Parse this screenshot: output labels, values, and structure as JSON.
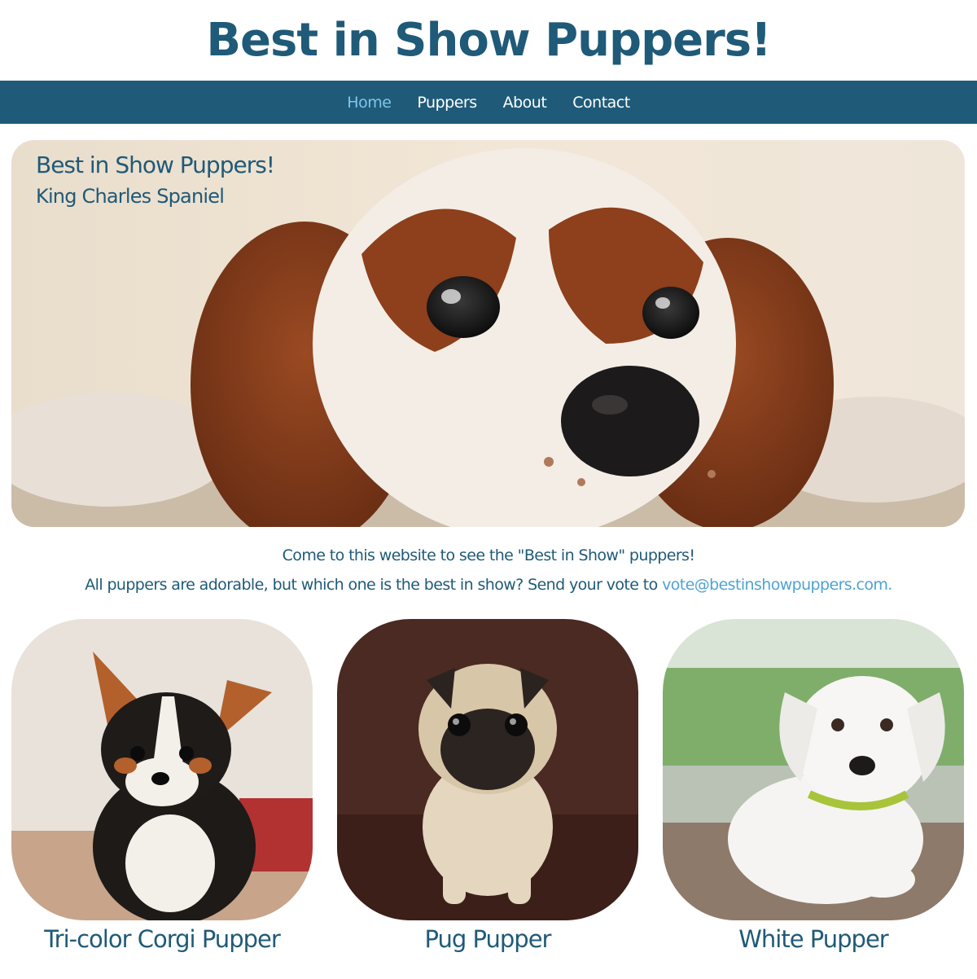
{
  "header": {
    "title": "Best in Show Puppers!"
  },
  "nav": {
    "items": [
      {
        "label": "Home",
        "active": true
      },
      {
        "label": "Puppers",
        "active": false
      },
      {
        "label": "About",
        "active": false
      },
      {
        "label": "Contact",
        "active": false
      }
    ]
  },
  "hero": {
    "title": "Best in Show Puppers!",
    "subtitle": "King Charles Spaniel"
  },
  "intro": {
    "line1": "Come to this website to see the \"Best in Show\" puppers!",
    "line2": "All puppers are adorable, but which one is the best in show? Send your vote to ",
    "email": "vote@bestinshowpuppers.com."
  },
  "cards": [
    {
      "caption": "Tri-color Corgi Pupper"
    },
    {
      "caption": "Pug Pupper"
    },
    {
      "caption": "White Pupper"
    }
  ],
  "colors": {
    "primary": "#1f5a78",
    "active_link": "#7fc6ea",
    "email_link": "#4fa3d1",
    "background": "#ffffff"
  }
}
